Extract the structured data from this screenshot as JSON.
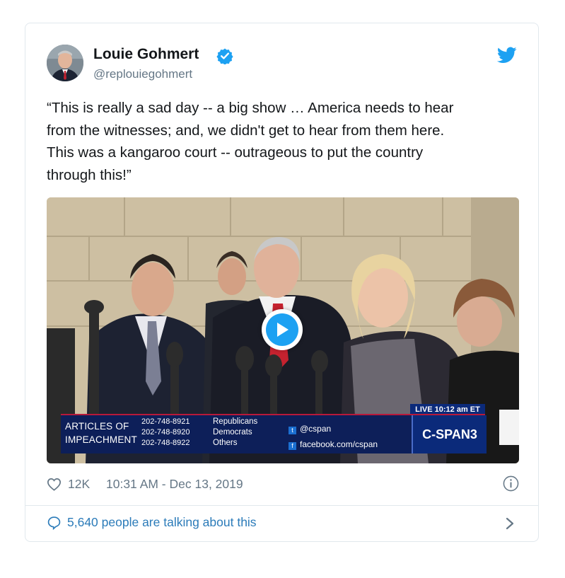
{
  "author": {
    "name": "Louie Gohmert",
    "handle": "@replouiegohmert",
    "verified": true
  },
  "tweet": {
    "text_lines": [
      "“This is really a sad day -- a big show … America needs to hear",
      "from the witnesses; and, we didn't get to hear from them here.",
      "This was a kangaroo court -- outrageous to put the country",
      "through this!”"
    ]
  },
  "video": {
    "lower_third": {
      "title_line1": "ARTICLES OF",
      "title_line2": "IMPEACHMENT",
      "phones": [
        "202-748-8921",
        "202-748-8920",
        "202-748-8922"
      ],
      "parties": [
        "Republicans",
        "Democrats",
        "Others"
      ],
      "twitter": "@cspan",
      "facebook": "facebook.com/cspan",
      "brand": "C-SPAN3",
      "live": "LIVE  10:12 am ET"
    }
  },
  "footer": {
    "likes": "12K",
    "timestamp": "10:31 AM - Dec 13, 2019",
    "talking": "5,640 people are talking about this"
  },
  "colors": {
    "accent": "#1da1f2",
    "link": "#2b7bb9",
    "muted": "#657786",
    "border": "#e1e8ed"
  }
}
